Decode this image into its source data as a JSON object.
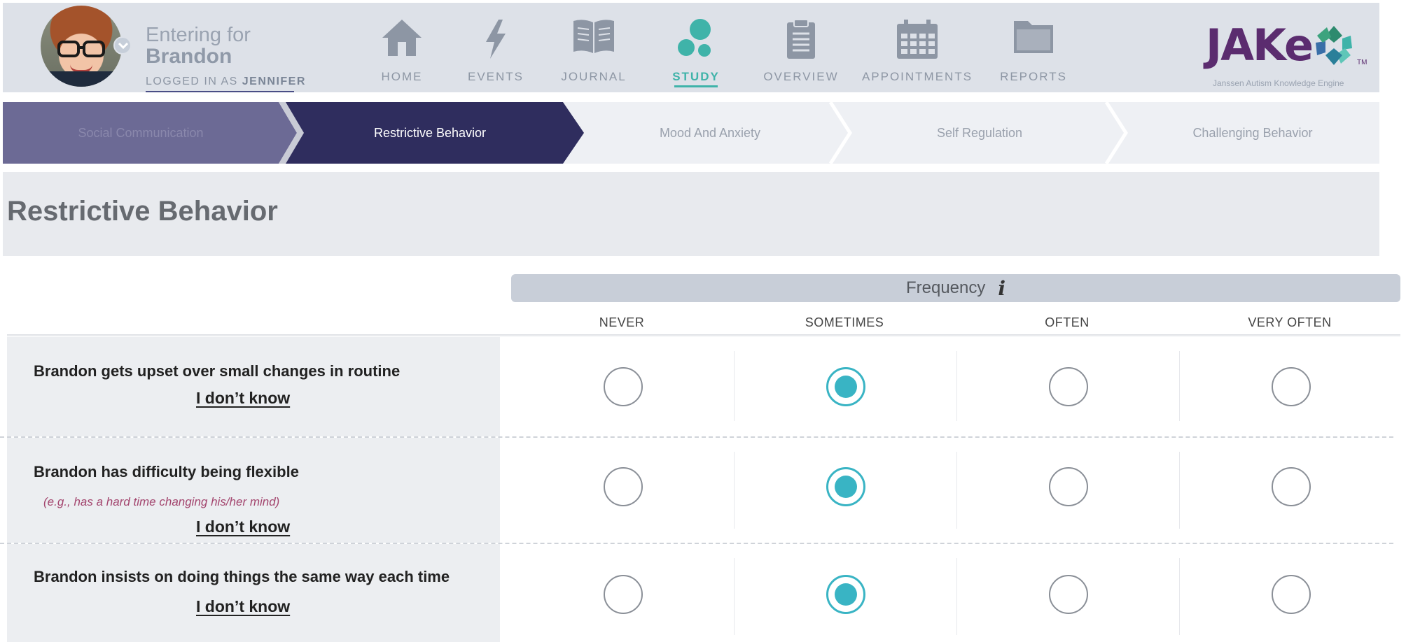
{
  "header": {
    "entering_label": "Entering for",
    "entering_name": "Brandon",
    "logged_in_prefix": "LOGGED IN AS",
    "logged_in_user": "JENNIFER",
    "nav": [
      {
        "label": "HOME",
        "icon": "home-icon",
        "active": false
      },
      {
        "label": "EVENTS",
        "icon": "lightning-icon",
        "active": false
      },
      {
        "label": "JOURNAL",
        "icon": "book-icon",
        "active": false
      },
      {
        "label": "STUDY",
        "icon": "bubbles-icon",
        "active": true
      },
      {
        "label": "OVERVIEW",
        "icon": "clipboard-icon",
        "active": false
      },
      {
        "label": "APPOINTMENTS",
        "icon": "calendar-icon",
        "active": false
      },
      {
        "label": "REPORTS",
        "icon": "folder-icon",
        "active": false
      }
    ],
    "logo_text": "JAKe",
    "logo_tm": "TM",
    "logo_subtitle": "Janssen Autism Knowledge Engine"
  },
  "stepper": {
    "steps": [
      {
        "label": "Social Communication",
        "state": "done"
      },
      {
        "label": "Restrictive Behavior",
        "state": "current"
      },
      {
        "label": "Mood And Anxiety",
        "state": "upcoming"
      },
      {
        "label": "Self Regulation",
        "state": "upcoming"
      },
      {
        "label": "Challenging Behavior",
        "state": "upcoming"
      }
    ]
  },
  "section": {
    "title": "Restrictive Behavior"
  },
  "survey": {
    "scale_title": "Frequency",
    "info_glyph": "i",
    "columns": [
      "NEVER",
      "SOMETIMES",
      "OFTEN",
      "VERY OFTEN"
    ],
    "dont_know_label": "I don’t know",
    "questions": [
      {
        "text": "Brandon gets upset over small changes in routine",
        "hint": "",
        "selected": "SOMETIMES"
      },
      {
        "text": "Brandon has difficulty being flexible",
        "hint": "(e.g., has a hard time changing his/her mind)",
        "selected": "SOMETIMES"
      },
      {
        "text": "Brandon insists on doing things the same way each time",
        "hint": "",
        "selected": "SOMETIMES"
      }
    ]
  },
  "colors": {
    "header_bg": "#dde1e8",
    "active_nav": "#3fb3a9",
    "step_done": "#6c6a95",
    "step_current": "#2f2d5e",
    "radio_selected": "#39b4c4",
    "hint_text": "#a3456e",
    "logo": "#5b2c6f"
  }
}
